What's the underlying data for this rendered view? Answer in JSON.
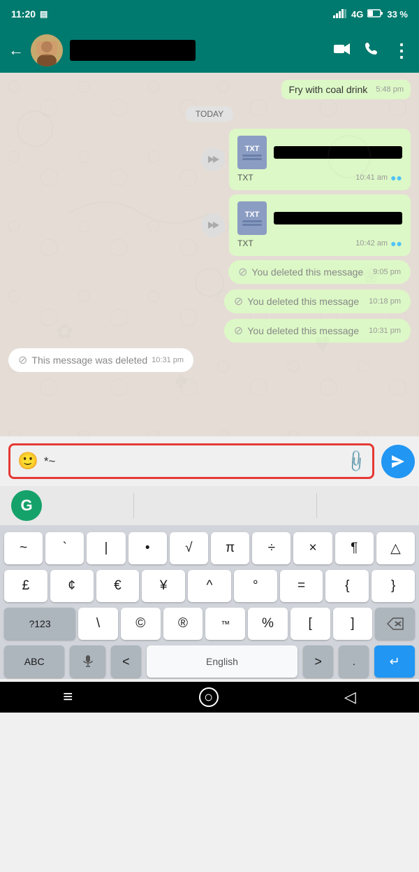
{
  "statusBar": {
    "time": "11:20",
    "signal": "4G",
    "battery": "33 %"
  },
  "header": {
    "contactName": "",
    "backLabel": "←",
    "videoCallIcon": "📹",
    "callIcon": "📞",
    "menuIcon": "⋮"
  },
  "chat": {
    "oldMessage": {
      "text": "Fry with coal drink",
      "time": "5:48 pm"
    },
    "todayLabel": "TODAY",
    "messages": [
      {
        "type": "file",
        "ext": "TXT",
        "time": "10:41 am",
        "hasForward": true
      },
      {
        "type": "file",
        "ext": "TXT",
        "time": "10:42 am",
        "hasForward": true
      },
      {
        "type": "deleted-sent",
        "text": "You deleted this message",
        "time": "9:05 pm"
      },
      {
        "type": "deleted-sent",
        "text": "You deleted this message",
        "time": "10:18 pm"
      },
      {
        "type": "deleted-sent",
        "text": "You deleted this message",
        "time": "10:31 pm"
      },
      {
        "type": "deleted-received",
        "text": "This message was deleted",
        "time": "10:31 pm"
      }
    ]
  },
  "inputBar": {
    "emojiIcon": "🙂",
    "inputText": "*~",
    "attachIcon": "📎",
    "sendIcon": "➤"
  },
  "grammarly": {
    "label": "G"
  },
  "keyboard": {
    "row1": [
      "~",
      "`",
      "|",
      "•",
      "√",
      "π",
      "÷",
      "×",
      "¶",
      "△"
    ],
    "row2": [
      "£",
      "¢",
      "€",
      "¥",
      "^",
      "°",
      "=",
      "{",
      "}"
    ],
    "row3left": "?123",
    "row3": [
      "\\",
      "©",
      "®",
      "™",
      "%",
      "[",
      "]"
    ],
    "row3right": "⌫",
    "row4left": "ABC",
    "row4mic": "🎤",
    "row4lesser": "<",
    "row4space": "English",
    "row4greater": ">",
    "row4dot": ".",
    "row4enter": "↵"
  },
  "bottomNav": {
    "menuIcon": "≡",
    "homeIcon": "○",
    "backIcon": "◁"
  }
}
